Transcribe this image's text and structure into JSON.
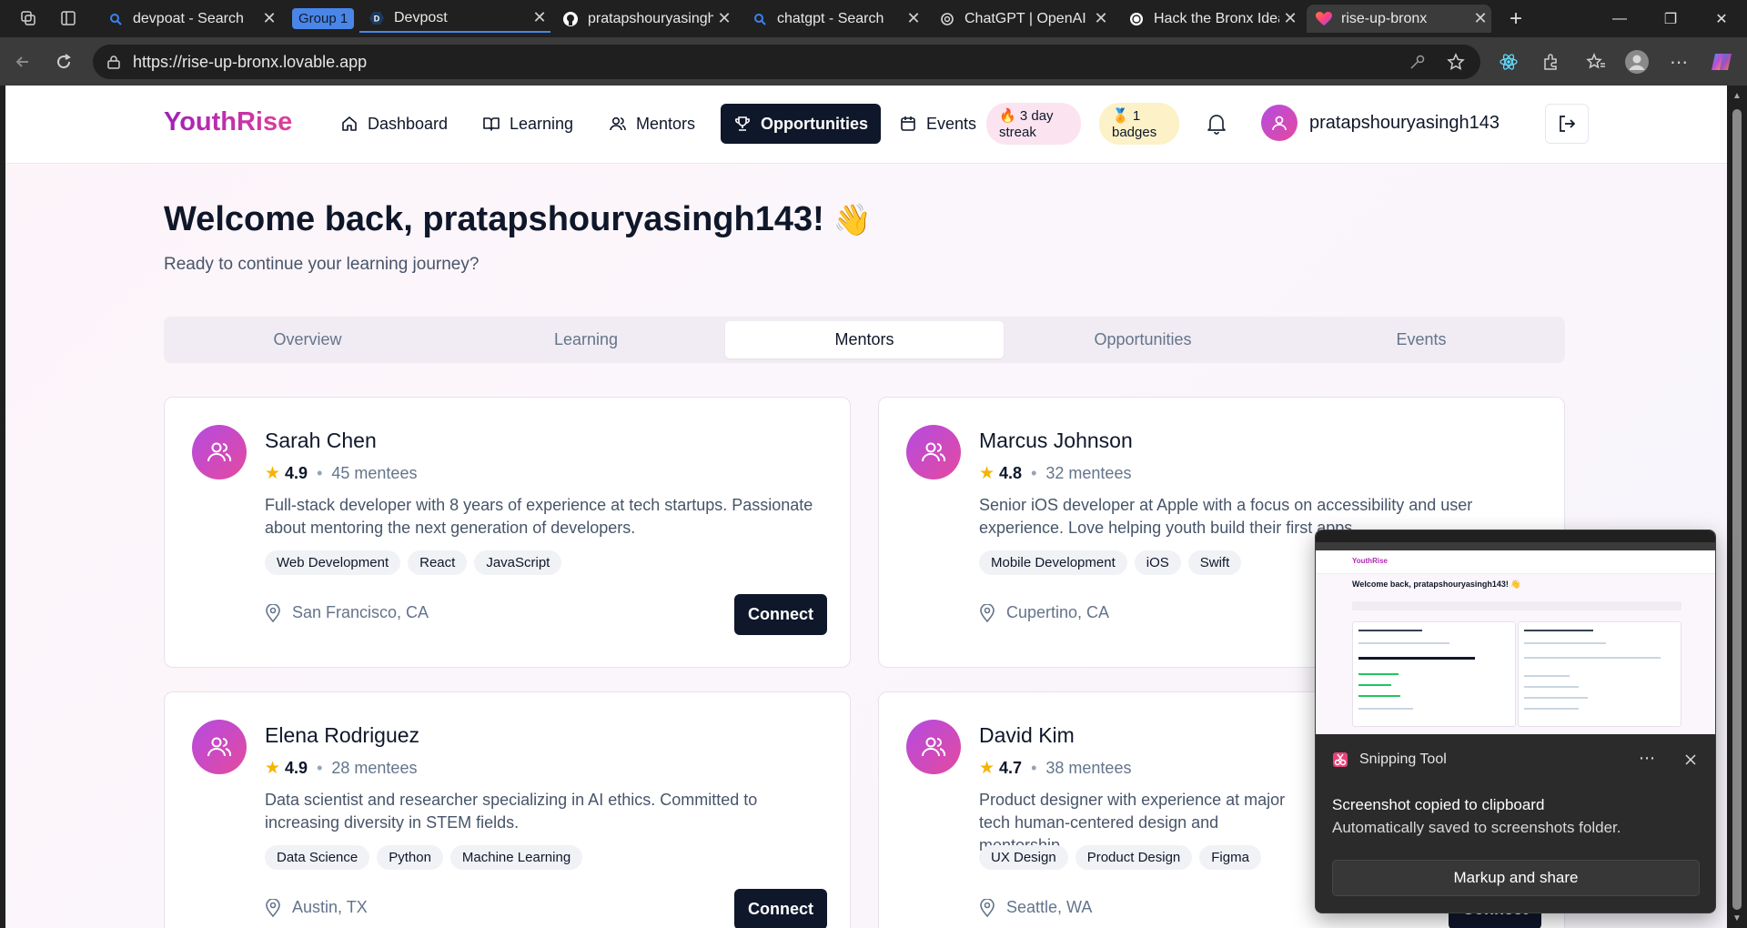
{
  "browser": {
    "tabs": [
      {
        "title": "devpoat - Search"
      },
      {
        "title": "Devpost"
      },
      {
        "title": "pratapshouryasingh"
      },
      {
        "title": "chatgpt - Search"
      },
      {
        "title": "ChatGPT | OpenAI"
      },
      {
        "title": "Hack the Bronx Idea"
      },
      {
        "title": "rise-up-bronx"
      }
    ],
    "group_label": "Group 1",
    "url": "https://rise-up-bronx.lovable.app"
  },
  "app": {
    "logo": "YouthRise",
    "nav": [
      {
        "label": "Dashboard",
        "icon": "home-icon"
      },
      {
        "label": "Learning",
        "icon": "book-icon"
      },
      {
        "label": "Mentors",
        "icon": "users-icon"
      },
      {
        "label": "Opportunities",
        "icon": "trophy-icon",
        "active": true
      },
      {
        "label": "Events",
        "icon": "calendar-icon"
      }
    ],
    "streak": {
      "emoji": "🔥",
      "line1": "3 day",
      "line2": "streak"
    },
    "badges": {
      "emoji": "🏅",
      "line1": "1",
      "line2": "badges"
    },
    "username": "pratapshouryasingh143"
  },
  "main": {
    "welcome": "Welcome back, pratapshouryasingh143!",
    "wave": "👋",
    "subtitle": "Ready to continue your learning journey?",
    "tabs": [
      "Overview",
      "Learning",
      "Mentors",
      "Opportunities",
      "Events"
    ],
    "active_tab": "Mentors",
    "connect_label": "Connect",
    "mentors": [
      {
        "name": "Sarah Chen",
        "rating": "4.9",
        "mentees": "45 mentees",
        "bio": "Full-stack developer with 8 years of experience at tech startups. Passionate about mentoring the next generation of developers.",
        "tags": [
          "Web Development",
          "React",
          "JavaScript"
        ],
        "location": "San Francisco, CA"
      },
      {
        "name": "Marcus Johnson",
        "rating": "4.8",
        "mentees": "32 mentees",
        "bio": "Senior iOS developer at Apple with a focus on accessibility and user experience. Love helping youth build their first apps.",
        "tags": [
          "Mobile Development",
          "iOS",
          "Swift"
        ],
        "location": "Cupertino, CA"
      },
      {
        "name": "Elena Rodriguez",
        "rating": "4.9",
        "mentees": "28 mentees",
        "bio": "Data scientist and researcher specializing in AI ethics. Committed to increasing diversity in STEM fields.",
        "tags": [
          "Data Science",
          "Python",
          "Machine Learning"
        ],
        "location": "Austin, TX"
      },
      {
        "name": "David Kim",
        "rating": "4.7",
        "mentees": "38 mentees",
        "bio": "Product designer with experience at major tech human-centered design and mentorship.",
        "tags": [
          "UX Design",
          "Product Design",
          "Figma"
        ],
        "location": "Seattle, WA"
      }
    ]
  },
  "toast": {
    "app_name": "Snipping Tool",
    "message": "Screenshot copied to clipboard",
    "detail": "Automatically saved to screenshots folder.",
    "action": "Markup and share",
    "thumb_logo": "YouthRise",
    "thumb_welcome": "Welcome back, pratapshouryasingh143! 👋"
  }
}
